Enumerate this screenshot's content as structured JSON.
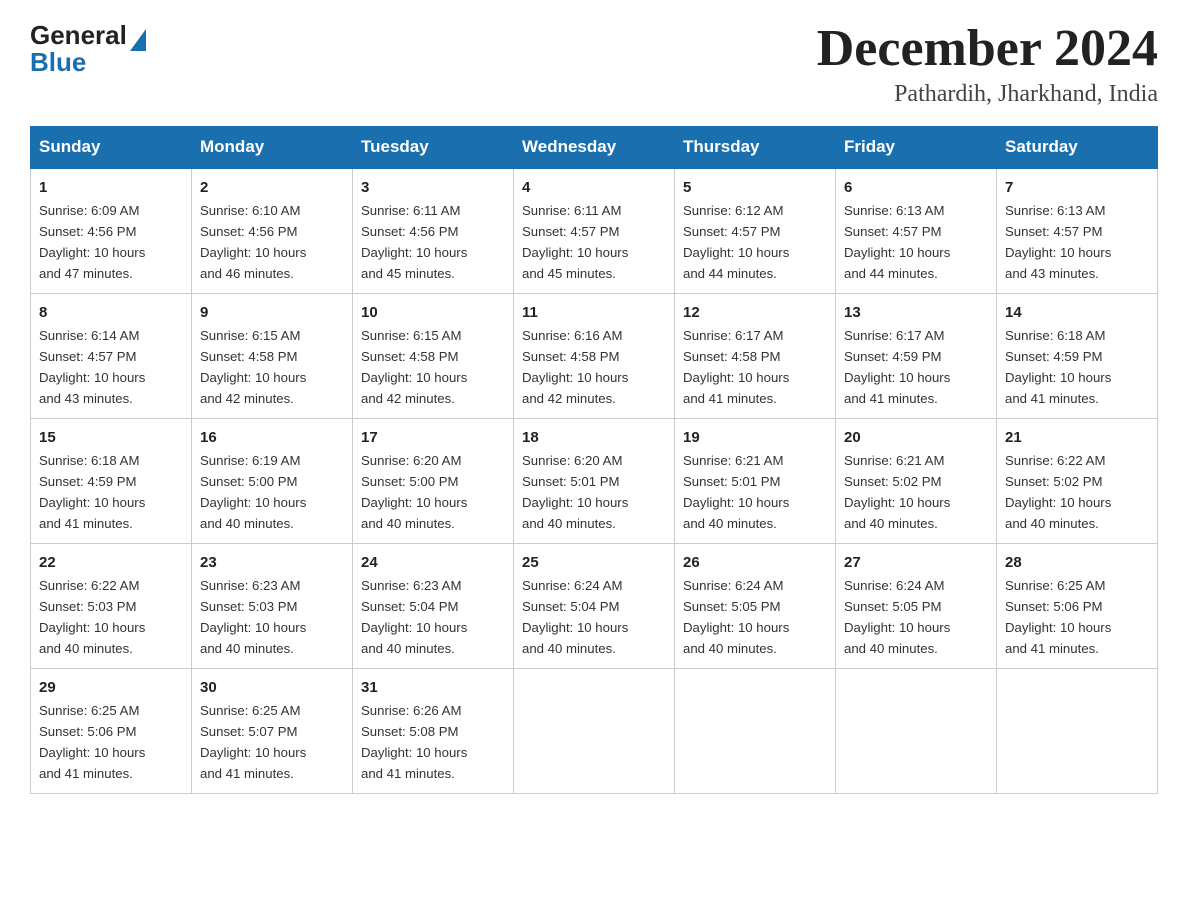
{
  "header": {
    "logo_general": "General",
    "logo_blue": "Blue",
    "month_title": "December 2024",
    "location": "Pathardih, Jharkhand, India"
  },
  "weekdays": [
    "Sunday",
    "Monday",
    "Tuesday",
    "Wednesday",
    "Thursday",
    "Friday",
    "Saturday"
  ],
  "weeks": [
    [
      {
        "day": "1",
        "sunrise": "6:09 AM",
        "sunset": "4:56 PM",
        "daylight": "10 hours and 47 minutes."
      },
      {
        "day": "2",
        "sunrise": "6:10 AM",
        "sunset": "4:56 PM",
        "daylight": "10 hours and 46 minutes."
      },
      {
        "day": "3",
        "sunrise": "6:11 AM",
        "sunset": "4:56 PM",
        "daylight": "10 hours and 45 minutes."
      },
      {
        "day": "4",
        "sunrise": "6:11 AM",
        "sunset": "4:57 PM",
        "daylight": "10 hours and 45 minutes."
      },
      {
        "day": "5",
        "sunrise": "6:12 AM",
        "sunset": "4:57 PM",
        "daylight": "10 hours and 44 minutes."
      },
      {
        "day": "6",
        "sunrise": "6:13 AM",
        "sunset": "4:57 PM",
        "daylight": "10 hours and 44 minutes."
      },
      {
        "day": "7",
        "sunrise": "6:13 AM",
        "sunset": "4:57 PM",
        "daylight": "10 hours and 43 minutes."
      }
    ],
    [
      {
        "day": "8",
        "sunrise": "6:14 AM",
        "sunset": "4:57 PM",
        "daylight": "10 hours and 43 minutes."
      },
      {
        "day": "9",
        "sunrise": "6:15 AM",
        "sunset": "4:58 PM",
        "daylight": "10 hours and 42 minutes."
      },
      {
        "day": "10",
        "sunrise": "6:15 AM",
        "sunset": "4:58 PM",
        "daylight": "10 hours and 42 minutes."
      },
      {
        "day": "11",
        "sunrise": "6:16 AM",
        "sunset": "4:58 PM",
        "daylight": "10 hours and 42 minutes."
      },
      {
        "day": "12",
        "sunrise": "6:17 AM",
        "sunset": "4:58 PM",
        "daylight": "10 hours and 41 minutes."
      },
      {
        "day": "13",
        "sunrise": "6:17 AM",
        "sunset": "4:59 PM",
        "daylight": "10 hours and 41 minutes."
      },
      {
        "day": "14",
        "sunrise": "6:18 AM",
        "sunset": "4:59 PM",
        "daylight": "10 hours and 41 minutes."
      }
    ],
    [
      {
        "day": "15",
        "sunrise": "6:18 AM",
        "sunset": "4:59 PM",
        "daylight": "10 hours and 41 minutes."
      },
      {
        "day": "16",
        "sunrise": "6:19 AM",
        "sunset": "5:00 PM",
        "daylight": "10 hours and 40 minutes."
      },
      {
        "day": "17",
        "sunrise": "6:20 AM",
        "sunset": "5:00 PM",
        "daylight": "10 hours and 40 minutes."
      },
      {
        "day": "18",
        "sunrise": "6:20 AM",
        "sunset": "5:01 PM",
        "daylight": "10 hours and 40 minutes."
      },
      {
        "day": "19",
        "sunrise": "6:21 AM",
        "sunset": "5:01 PM",
        "daylight": "10 hours and 40 minutes."
      },
      {
        "day": "20",
        "sunrise": "6:21 AM",
        "sunset": "5:02 PM",
        "daylight": "10 hours and 40 minutes."
      },
      {
        "day": "21",
        "sunrise": "6:22 AM",
        "sunset": "5:02 PM",
        "daylight": "10 hours and 40 minutes."
      }
    ],
    [
      {
        "day": "22",
        "sunrise": "6:22 AM",
        "sunset": "5:03 PM",
        "daylight": "10 hours and 40 minutes."
      },
      {
        "day": "23",
        "sunrise": "6:23 AM",
        "sunset": "5:03 PM",
        "daylight": "10 hours and 40 minutes."
      },
      {
        "day": "24",
        "sunrise": "6:23 AM",
        "sunset": "5:04 PM",
        "daylight": "10 hours and 40 minutes."
      },
      {
        "day": "25",
        "sunrise": "6:24 AM",
        "sunset": "5:04 PM",
        "daylight": "10 hours and 40 minutes."
      },
      {
        "day": "26",
        "sunrise": "6:24 AM",
        "sunset": "5:05 PM",
        "daylight": "10 hours and 40 minutes."
      },
      {
        "day": "27",
        "sunrise": "6:24 AM",
        "sunset": "5:05 PM",
        "daylight": "10 hours and 40 minutes."
      },
      {
        "day": "28",
        "sunrise": "6:25 AM",
        "sunset": "5:06 PM",
        "daylight": "10 hours and 41 minutes."
      }
    ],
    [
      {
        "day": "29",
        "sunrise": "6:25 AM",
        "sunset": "5:06 PM",
        "daylight": "10 hours and 41 minutes."
      },
      {
        "day": "30",
        "sunrise": "6:25 AM",
        "sunset": "5:07 PM",
        "daylight": "10 hours and 41 minutes."
      },
      {
        "day": "31",
        "sunrise": "6:26 AM",
        "sunset": "5:08 PM",
        "daylight": "10 hours and 41 minutes."
      },
      null,
      null,
      null,
      null
    ]
  ],
  "labels": {
    "sunrise": "Sunrise:",
    "sunset": "Sunset:",
    "daylight": "Daylight:"
  }
}
